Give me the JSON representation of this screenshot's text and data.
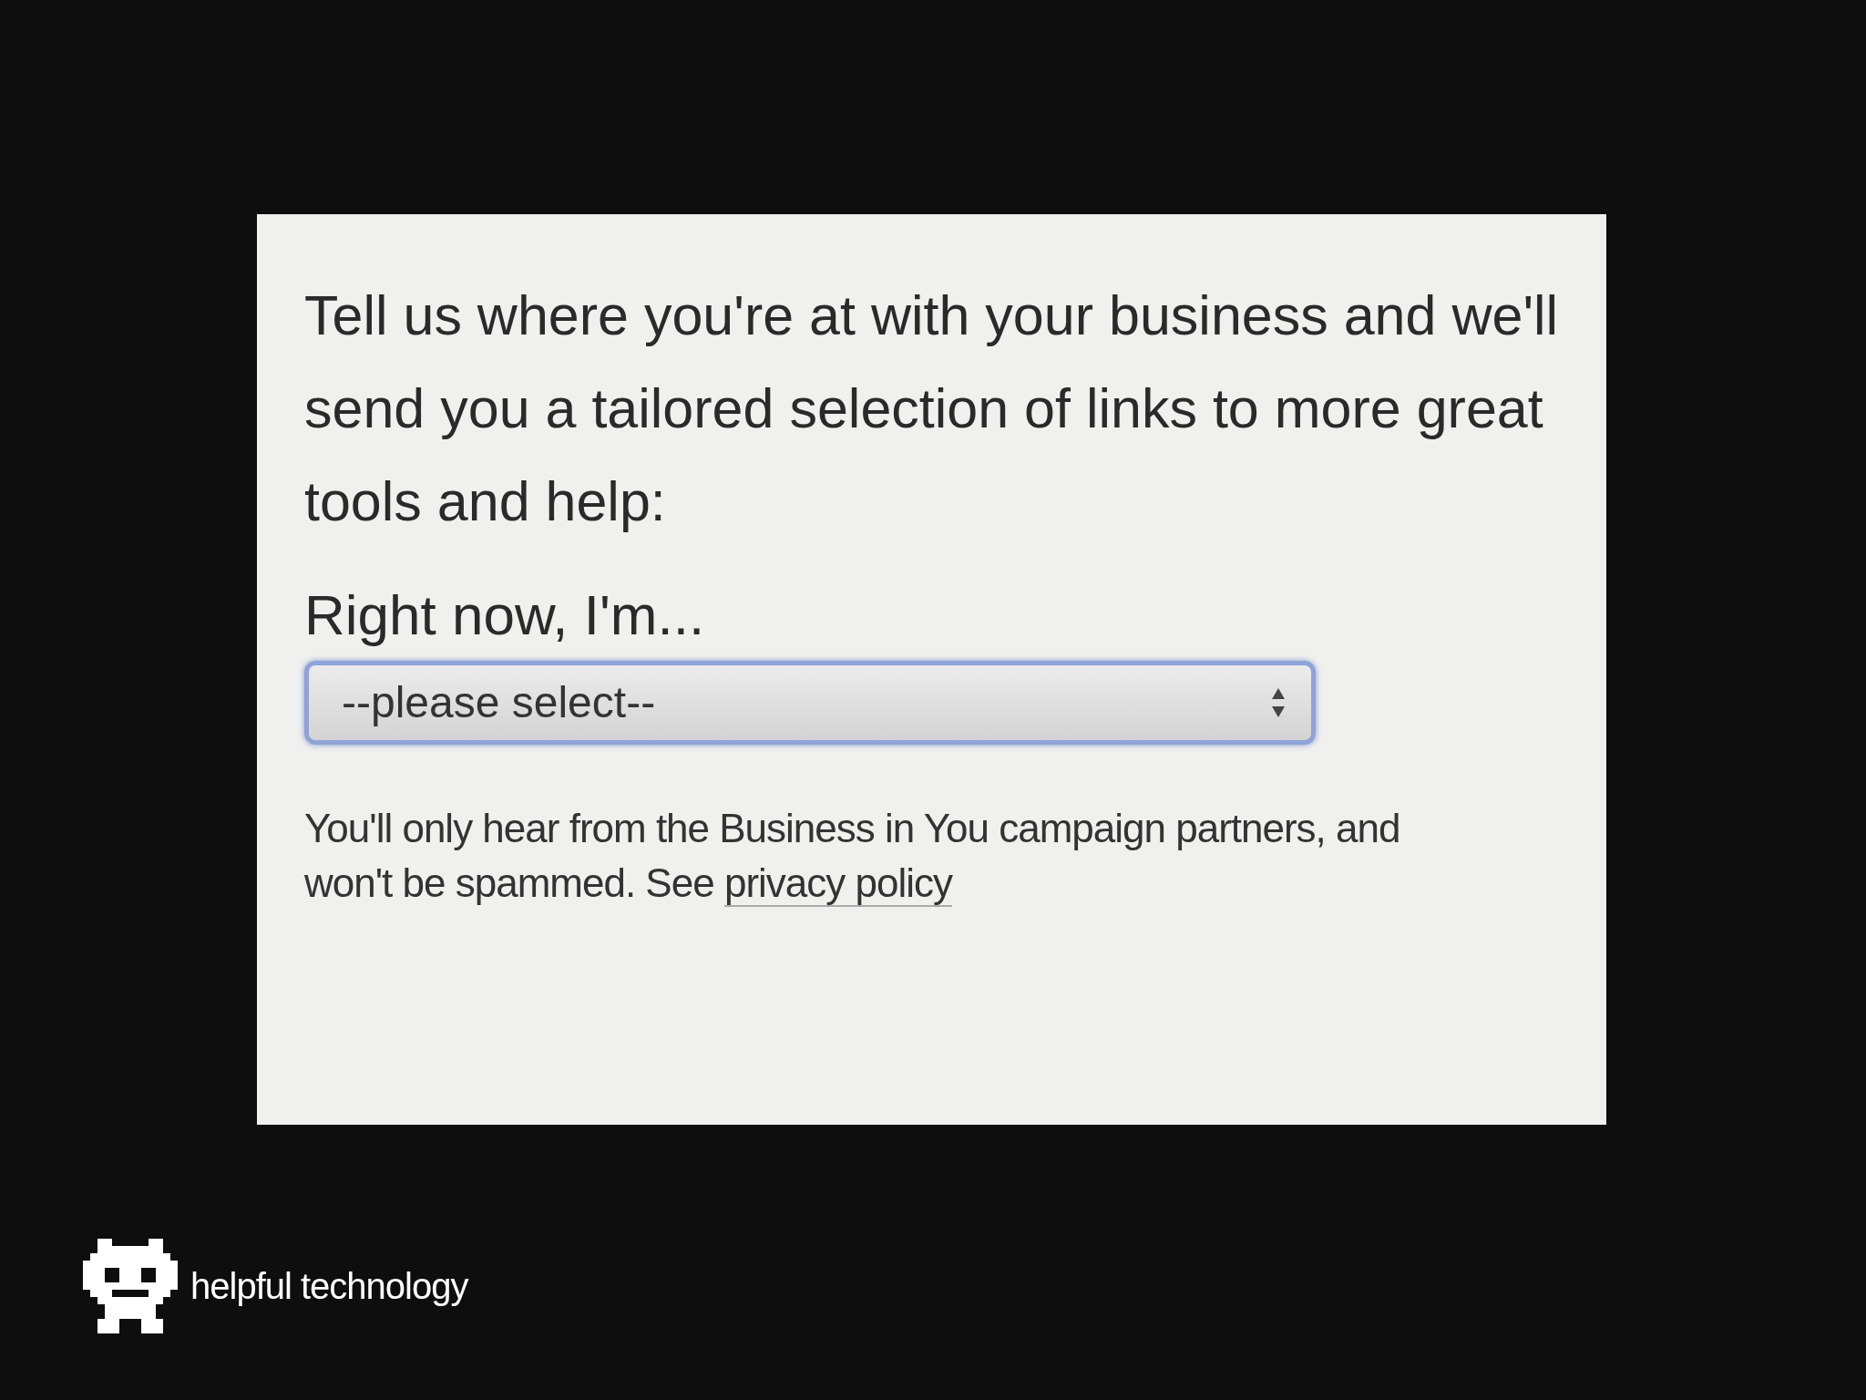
{
  "form": {
    "intro": "Tell us where you're at with your business and we'll send you a tailored selection of links to more great tools and help:",
    "field_label": "Right now, I'm...",
    "select": {
      "value": "--please select--",
      "focused": true
    },
    "notice": "You'll only hear from the Business in You campaign partners, and won't be spammed. See",
    "link": "privacy policy"
  },
  "branding": {
    "name": "helpful technology"
  }
}
